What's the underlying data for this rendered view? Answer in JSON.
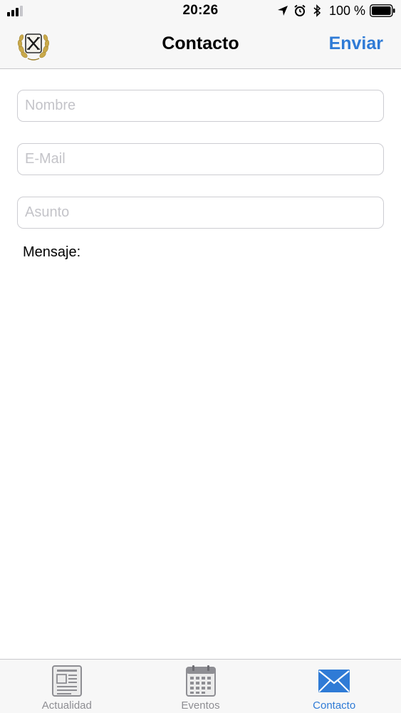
{
  "status_bar": {
    "time": "20:26",
    "battery_percent": "100 %"
  },
  "nav": {
    "title": "Contacto",
    "action_label": "Enviar",
    "logo_icon": "laurel-x-logo"
  },
  "form": {
    "name_placeholder": "Nombre",
    "email_placeholder": "E-Mail",
    "subject_placeholder": "Asunto",
    "message_label": "Mensaje:"
  },
  "tabs": [
    {
      "label": "Actualidad",
      "icon": "newspaper-icon",
      "active": false
    },
    {
      "label": "Eventos",
      "icon": "calendar-icon",
      "active": false
    },
    {
      "label": "Contacto",
      "icon": "envelope-icon",
      "active": true
    }
  ],
  "colors": {
    "accent": "#2f7bd6",
    "inactive": "#8e8e93",
    "bar_background": "#f7f7f7"
  }
}
